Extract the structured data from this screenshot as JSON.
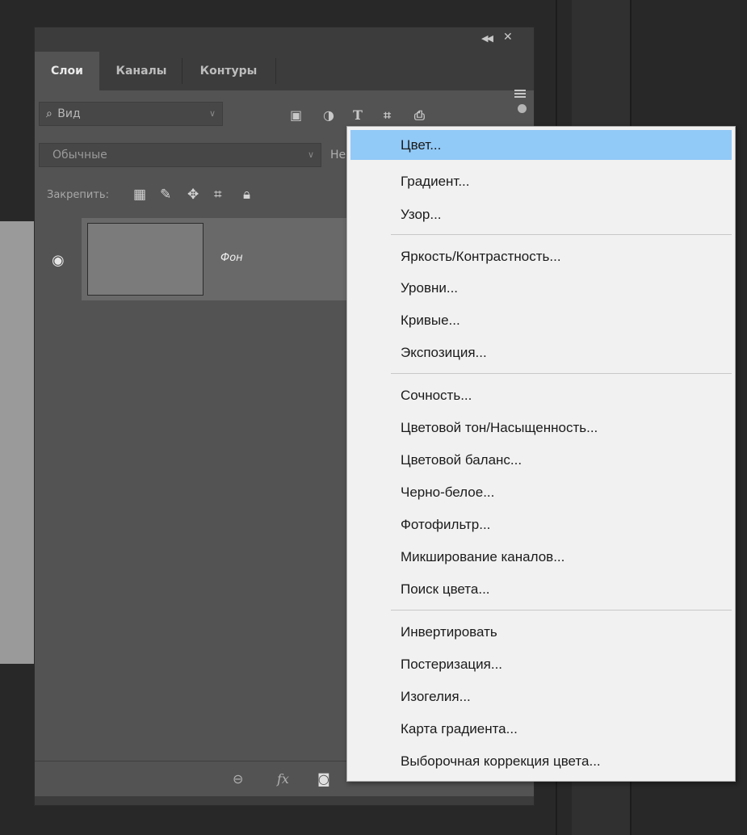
{
  "colors": {
    "app_background": "#282828",
    "panel_background": "#535353",
    "menu_background": "#f1f1f1",
    "menu_highlight": "#91c9f7"
  },
  "panel": {
    "header_icons": {
      "collapse": "double-chevron-left-icon",
      "close": "close-icon"
    },
    "tabs": [
      {
        "label": "Слои",
        "active": true
      },
      {
        "label": "Каналы",
        "active": false
      },
      {
        "label": "Контуры",
        "active": false
      }
    ],
    "menu_icon": "hamburger-icon",
    "filter": {
      "placeholder": "Вид",
      "icon": "search-icon",
      "type_icons": [
        "image-filter-icon",
        "adjustment-filter-icon",
        "type-filter-icon",
        "shape-filter-icon",
        "smart-object-filter-icon"
      ]
    },
    "blend_mode": "Обычные",
    "opacity_label_partial": "Не",
    "lock": {
      "label": "Закрепить:",
      "icons": [
        "lock-transparent-pixels-icon",
        "lock-image-pixels-icon",
        "lock-position-icon",
        "lock-artboard-icon",
        "lock-all-icon"
      ]
    },
    "layers": [
      {
        "name": "Фон",
        "visible": true
      }
    ],
    "bottom_icons": [
      "link-layers-icon",
      "layer-style-fx-icon",
      "add-mask-icon"
    ]
  },
  "menu": {
    "groups": [
      [
        "Цвет...",
        "Градиент...",
        "Узор..."
      ],
      [
        "Яркость/Контрастность...",
        "Уровни...",
        "Кривые...",
        "Экспозиция..."
      ],
      [
        "Сочность...",
        "Цветовой тон/Насыщенность...",
        "Цветовой баланс...",
        "Черно-белое...",
        "Фотофильтр...",
        "Микширование каналов...",
        "Поиск цвета..."
      ],
      [
        "Инвертировать",
        "Постеризация...",
        "Изогелия...",
        "Карта градиента...",
        "Выборочная коррекция цвета..."
      ]
    ],
    "highlighted_item": "Цвет..."
  }
}
